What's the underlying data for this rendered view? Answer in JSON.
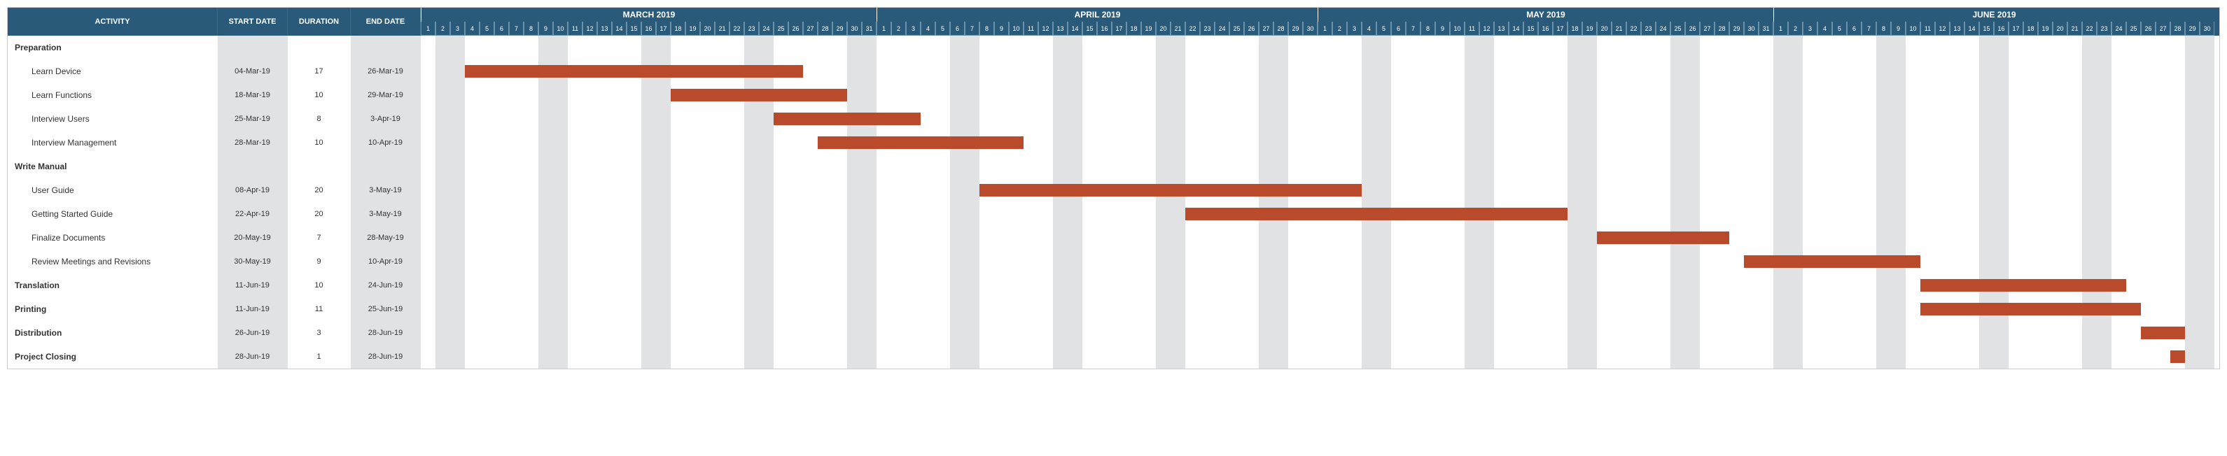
{
  "headers": {
    "activity": "ACTIVITY",
    "start": "START DATE",
    "duration": "DURATION",
    "end": "END DATE"
  },
  "colors": {
    "header_bg": "#295a7a",
    "bar": "#b94a2c",
    "weekend": "#e1e2e4"
  },
  "months": [
    {
      "label": "MARCH 2019",
      "days": 31,
      "startIndex": 0
    },
    {
      "label": "APRIL 2019",
      "days": 30,
      "startIndex": 31
    },
    {
      "label": "MAY 2019",
      "days": 31,
      "startIndex": 61
    },
    {
      "label": "JUNE 2019",
      "days": 30,
      "startIndex": 92
    }
  ],
  "totalDays": 122,
  "firstWeekendOffset": 1,
  "rows": [
    {
      "type": "group",
      "label": "Preparation",
      "start": "",
      "dur": "",
      "end": ""
    },
    {
      "type": "task",
      "label": "Learn Device",
      "start": "04-Mar-19",
      "dur": "17",
      "end": "26-Mar-19",
      "barStart": 3,
      "barLen": 23
    },
    {
      "type": "task",
      "label": "Learn Functions",
      "start": "18-Mar-19",
      "dur": "10",
      "end": "29-Mar-19",
      "barStart": 17,
      "barLen": 12
    },
    {
      "type": "task",
      "label": "Interview Users",
      "start": "25-Mar-19",
      "dur": "8",
      "end": "3-Apr-19",
      "barStart": 24,
      "barLen": 10
    },
    {
      "type": "task",
      "label": "Interview Management",
      "start": "28-Mar-19",
      "dur": "10",
      "end": "10-Apr-19",
      "barStart": 27,
      "barLen": 14
    },
    {
      "type": "group",
      "label": "Write Manual",
      "start": "",
      "dur": "",
      "end": ""
    },
    {
      "type": "task",
      "label": "User Guide",
      "start": "08-Apr-19",
      "dur": "20",
      "end": "3-May-19",
      "barStart": 38,
      "barLen": 26
    },
    {
      "type": "task",
      "label": "Getting Started Guide",
      "start": "22-Apr-19",
      "dur": "20",
      "end": "3-May-19",
      "barStart": 52,
      "barLen": 26
    },
    {
      "type": "task",
      "label": "Finalize Documents",
      "start": "20-May-19",
      "dur": "7",
      "end": "28-May-19",
      "barStart": 80,
      "barLen": 9
    },
    {
      "type": "task",
      "label": "Review Meetings and Revisions",
      "start": "30-May-19",
      "dur": "9",
      "end": "10-Apr-19",
      "barStart": 90,
      "barLen": 12
    },
    {
      "type": "top",
      "label": "Translation",
      "start": "11-Jun-19",
      "dur": "10",
      "end": "24-Jun-19",
      "barStart": 102,
      "barLen": 14
    },
    {
      "type": "top",
      "label": "Printing",
      "start": "11-Jun-19",
      "dur": "11",
      "end": "25-Jun-19",
      "barStart": 102,
      "barLen": 15
    },
    {
      "type": "top",
      "label": "Distribution",
      "start": "26-Jun-19",
      "dur": "3",
      "end": "28-Jun-19",
      "barStart": 117,
      "barLen": 3
    },
    {
      "type": "top",
      "label": "Project Closing",
      "start": "28-Jun-19",
      "dur": "1",
      "end": "28-Jun-19",
      "barStart": 119,
      "barLen": 1
    }
  ],
  "chart_data": {
    "type": "bar",
    "title": "Project Gantt Chart (Mar–Jun 2019)",
    "xlabel": "Date",
    "ylabel": "Activity",
    "x_range": [
      "2019-03-01",
      "2019-06-30"
    ],
    "series": [
      {
        "name": "Learn Device",
        "start": "2019-03-04",
        "end": "2019-03-26",
        "duration_days": 17,
        "group": "Preparation"
      },
      {
        "name": "Learn Functions",
        "start": "2019-03-18",
        "end": "2019-03-29",
        "duration_days": 10,
        "group": "Preparation"
      },
      {
        "name": "Interview Users",
        "start": "2019-03-25",
        "end": "2019-04-03",
        "duration_days": 8,
        "group": "Preparation"
      },
      {
        "name": "Interview Management",
        "start": "2019-03-28",
        "end": "2019-04-10",
        "duration_days": 10,
        "group": "Preparation"
      },
      {
        "name": "User Guide",
        "start": "2019-04-08",
        "end": "2019-05-03",
        "duration_days": 20,
        "group": "Write Manual"
      },
      {
        "name": "Getting Started Guide",
        "start": "2019-04-22",
        "end": "2019-05-03",
        "duration_days": 20,
        "group": "Write Manual"
      },
      {
        "name": "Finalize Documents",
        "start": "2019-05-20",
        "end": "2019-05-28",
        "duration_days": 7,
        "group": "Write Manual"
      },
      {
        "name": "Review Meetings and Revisions",
        "start": "2019-05-30",
        "end": "2019-04-10",
        "duration_days": 9,
        "group": "Write Manual"
      },
      {
        "name": "Translation",
        "start": "2019-06-11",
        "end": "2019-06-24",
        "duration_days": 10,
        "group": ""
      },
      {
        "name": "Printing",
        "start": "2019-06-11",
        "end": "2019-06-25",
        "duration_days": 11,
        "group": ""
      },
      {
        "name": "Distribution",
        "start": "2019-06-26",
        "end": "2019-06-28",
        "duration_days": 3,
        "group": ""
      },
      {
        "name": "Project Closing",
        "start": "2019-06-28",
        "end": "2019-06-28",
        "duration_days": 1,
        "group": ""
      }
    ]
  }
}
